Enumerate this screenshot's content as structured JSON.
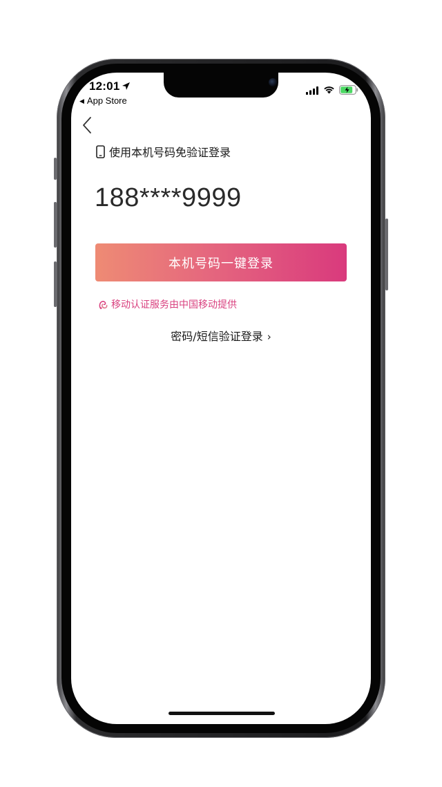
{
  "status_bar": {
    "time": "12:01",
    "back_app_label": "App Store",
    "icons": [
      "location-arrow-icon",
      "cellular-signal-icon",
      "wifi-icon",
      "battery-charging-icon"
    ],
    "battery_color": "#4cd964"
  },
  "nav": {
    "back_icon": "chevron-left-icon"
  },
  "login": {
    "local_label": "使用本机号码免验证登录",
    "masked_number": "188****9999",
    "one_click_button": "本机号码一键登录",
    "provider_note": "移动认证服务由中国移动提供",
    "alt_login": "密码/短信验证登录",
    "alt_chevron": "›"
  },
  "colors": {
    "button_gradient_start": "#ee8b74",
    "button_gradient_end": "#d93a7d",
    "provider_text": "#d9417f"
  }
}
